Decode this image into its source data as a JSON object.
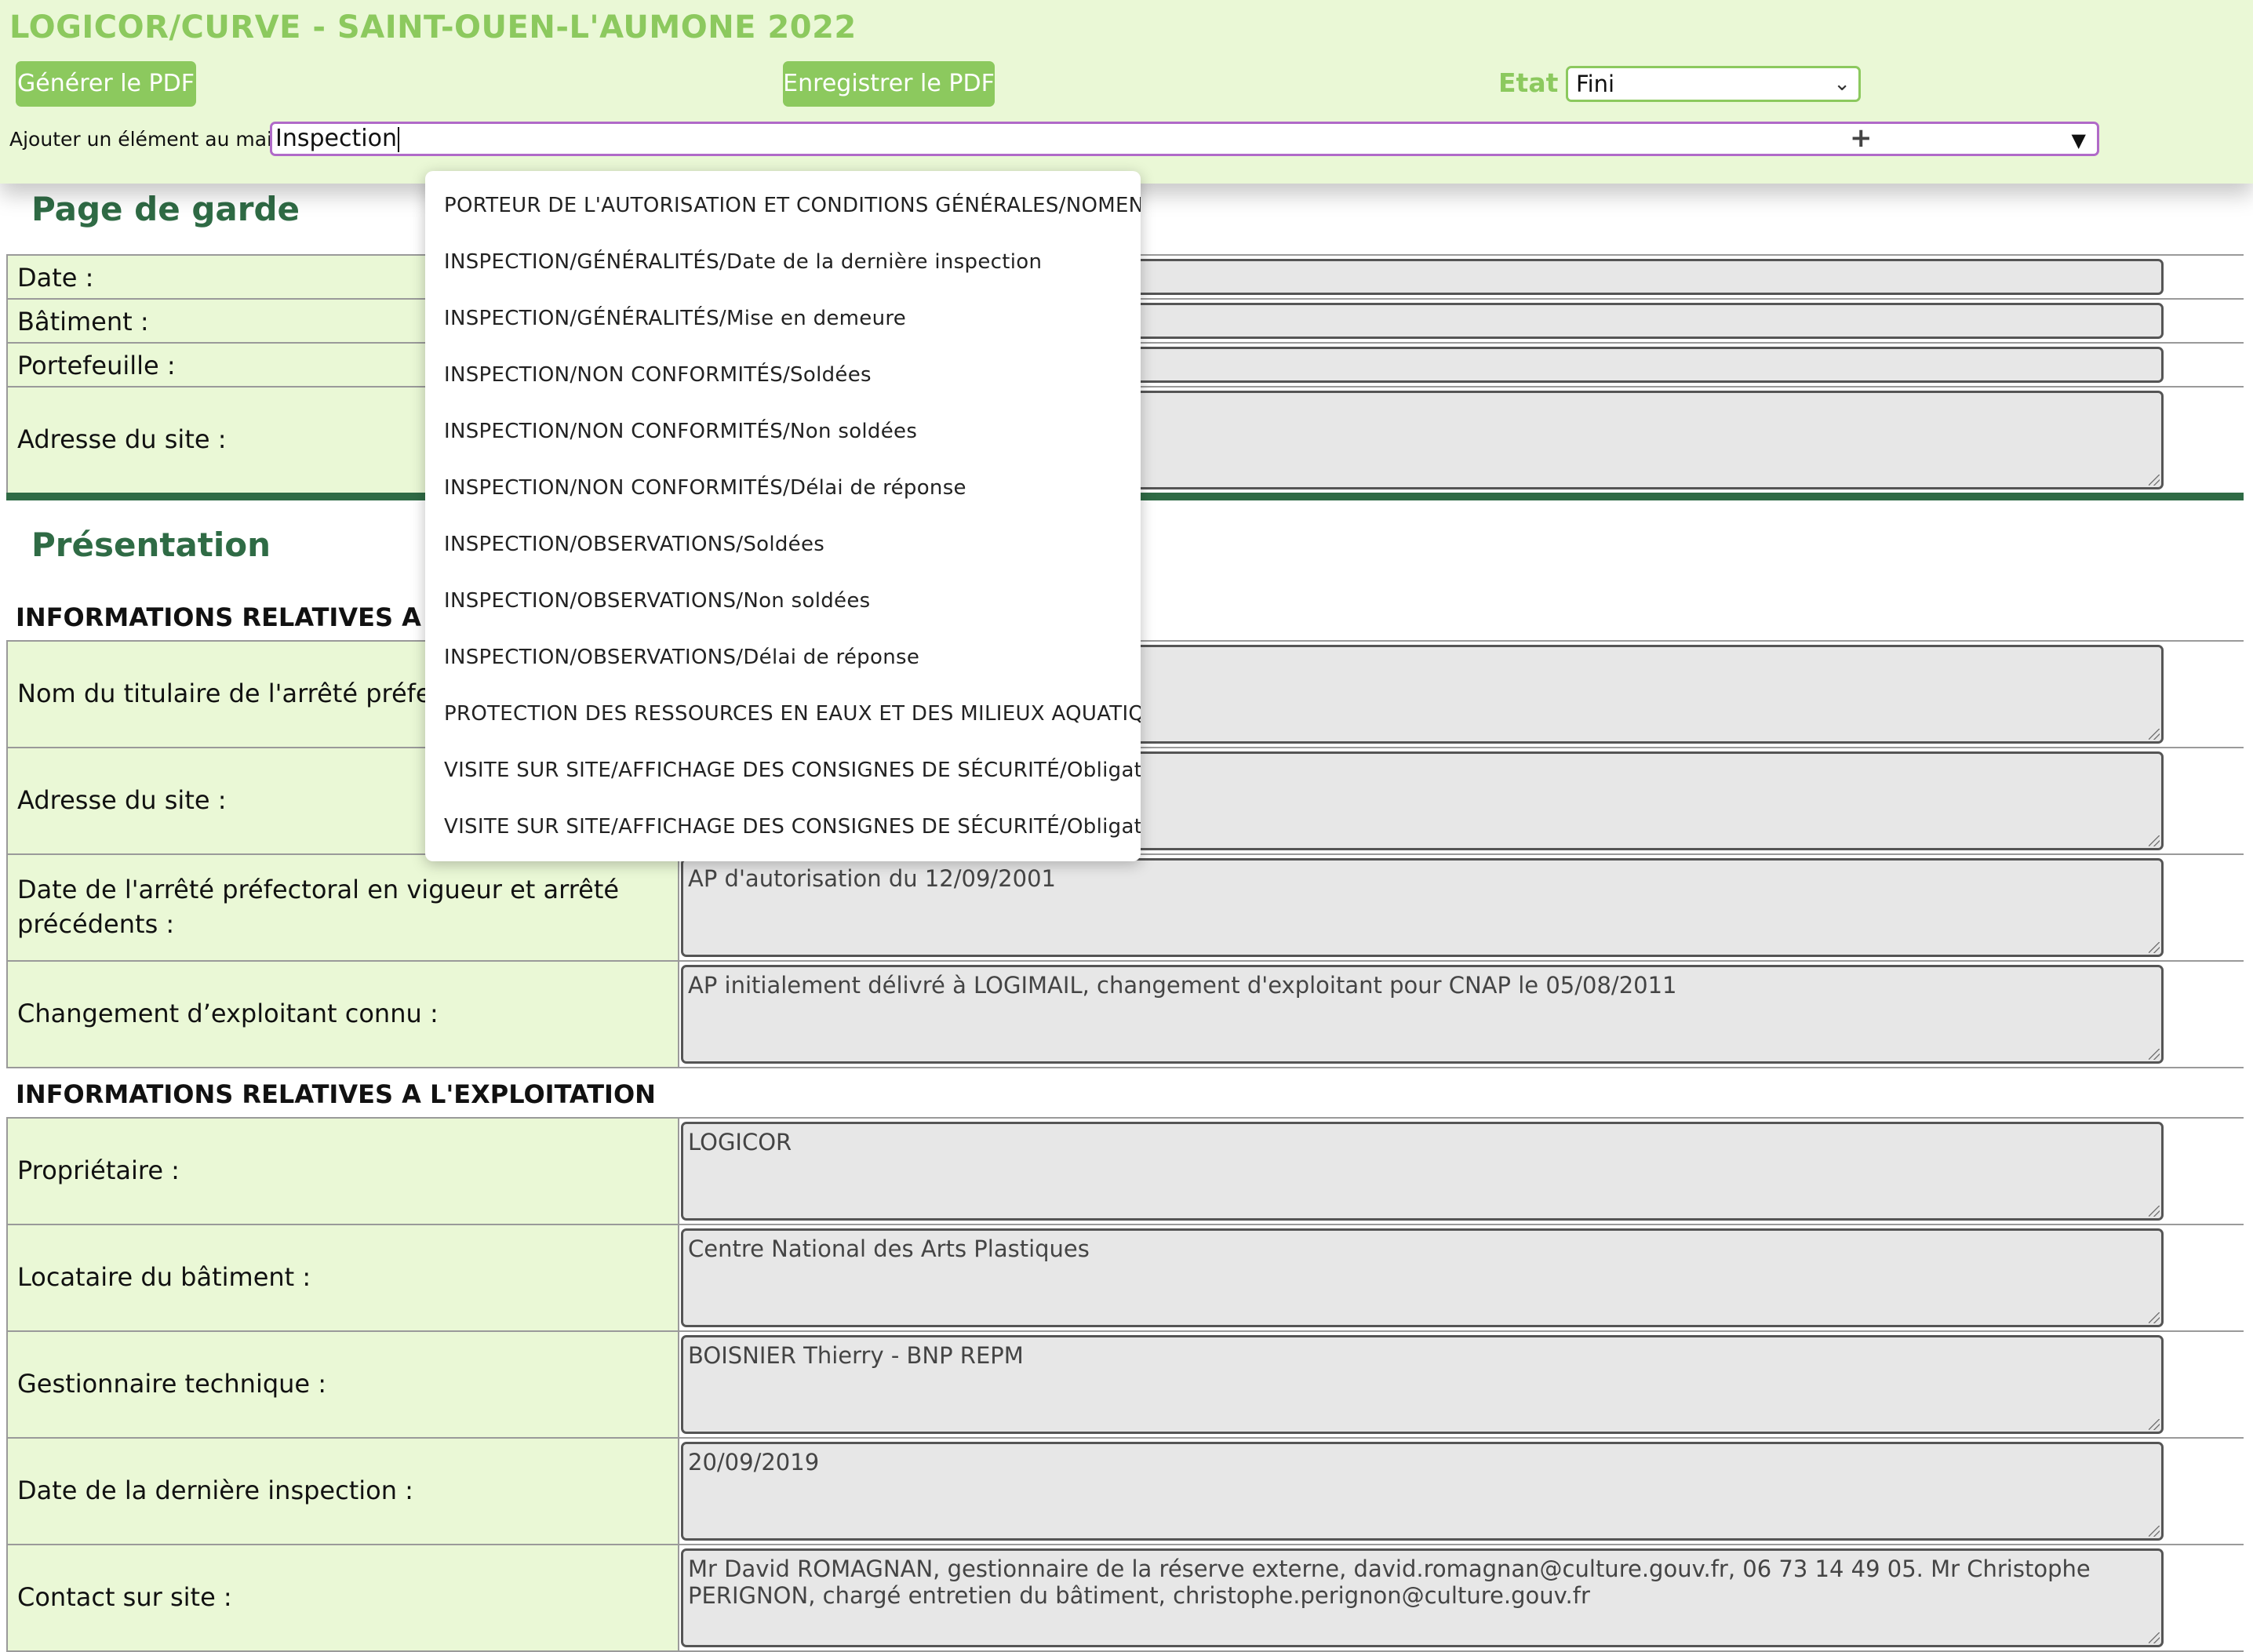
{
  "header": {
    "title": "LOGICOR/CURVE - SAINT-OUEN-L'AUMONE 2022",
    "generate_pdf": "Générer le PDF",
    "save_pdf": "Enregistrer le PDF",
    "etat_label": "Etat :",
    "etat_value": "Fini",
    "add_label": "Ajouter un élément au main :",
    "add_value": "Inspection",
    "plus": "+"
  },
  "dropdown": {
    "items": [
      "PORTEUR DE L'AUTORISATION ET CONDITIONS GÉNÉRALES/NOMENCLATURE",
      "INSPECTION/GÉNÉRALITÉS/Date de la dernière inspection",
      "INSPECTION/GÉNÉRALITÉS/Mise en demeure",
      "INSPECTION/NON CONFORMITÉS/Soldées",
      "INSPECTION/NON CONFORMITÉS/Non soldées",
      "INSPECTION/NON CONFORMITÉS/Délai de réponse",
      "INSPECTION/OBSERVATIONS/Soldées",
      "INSPECTION/OBSERVATIONS/Non soldées",
      "INSPECTION/OBSERVATIONS/Délai de réponse",
      "PROTECTION DES RESSOURCES EN EAUX ET DES MILIEUX AQUATIQUES",
      "VISITE SUR SITE/AFFICHAGE DES CONSIGNES DE SÉCURITÉ/Obligations",
      "VISITE SUR SITE/AFFICHAGE DES CONSIGNES DE SÉCURITÉ/Obligations"
    ]
  },
  "page_de_garde": {
    "title": "Page de garde",
    "rows": [
      {
        "label": "Date :",
        "value": ""
      },
      {
        "label": "Bâtiment :",
        "value": ""
      },
      {
        "label": "Portefeuille :",
        "value": ""
      },
      {
        "label": "Adresse du site :",
        "value": ""
      }
    ]
  },
  "presentation": {
    "title": "Présentation",
    "arrete_heading": "INFORMATIONS RELATIVES A L'ARRÊTÉ PRÉFECTORAL",
    "arrete_rows": [
      {
        "label": "Nom du titulaire de l'arrêté préfectoral :",
        "value": ""
      },
      {
        "label": "Adresse du site :",
        "value": ""
      },
      {
        "label": "Date de l'arrêté préfectoral en vigueur et arrêté précédents :",
        "value": "AP d'autorisation du 12/09/2001"
      },
      {
        "label": "Changement d’exploitant connu :",
        "value": "AP initialement délivré à LOGIMAIL, changement d'exploitant pour CNAP le 05/08/2011"
      }
    ],
    "exploitation_heading": "INFORMATIONS RELATIVES A L'EXPLOITATION",
    "exploitation_rows": [
      {
        "label": "Propriétaire :",
        "value": "LOGICOR"
      },
      {
        "label": "Locataire du bâtiment :",
        "value": "Centre National des Arts Plastiques"
      },
      {
        "label": "Gestionnaire technique :",
        "value": "BOISNIER Thierry - BNP REPM"
      },
      {
        "label": "Date de la dernière inspection :",
        "value": "20/09/2019"
      },
      {
        "label": "Contact sur site :",
        "value": "Mr David ROMAGNAN, gestionnaire de la réserve externe, david.romagnan@culture.gouv.fr, 06 73 14 49 05. Mr Christophe PERIGNON, chargé entretien du bâtiment, christophe.perignon@culture.gouv.fr"
      }
    ]
  }
}
